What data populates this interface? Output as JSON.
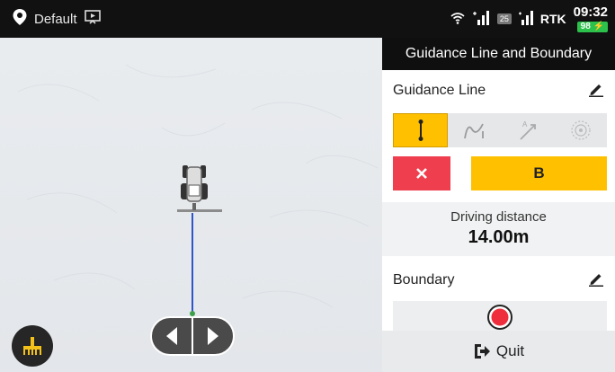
{
  "status_bar": {
    "profile_name": "Default",
    "lte_badge": "25",
    "rtk_label": "RTK",
    "time": "09:32",
    "battery": "98"
  },
  "panel": {
    "title": "Guidance Line and Boundary",
    "guidance_line_label": "Guidance Line",
    "modes": [
      {
        "icon": "straight-line-icon",
        "active": true
      },
      {
        "icon": "curve-line-icon",
        "active": false
      },
      {
        "icon": "a-plus-heading-icon",
        "active": false
      },
      {
        "icon": "pivot-circle-icon",
        "active": false
      }
    ],
    "point_b_label": "B",
    "driving_distance_label": "Driving distance",
    "driving_distance_value": "14.00m",
    "boundary_label": "Boundary",
    "quit_label": "Quit"
  },
  "colors": {
    "accent_yellow": "#ffc000",
    "cancel_red": "#ef3e4e",
    "guidance_line_blue": "#2f56c8",
    "header_black": "#0f0f0f"
  }
}
